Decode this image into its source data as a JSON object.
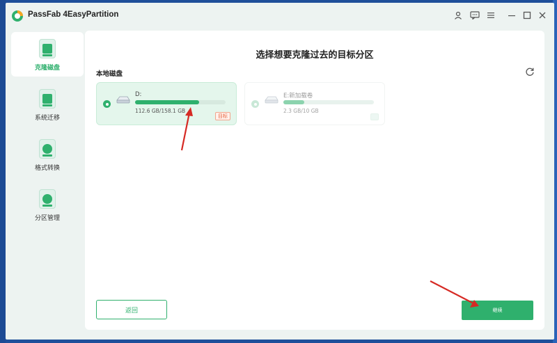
{
  "app": {
    "title": "PassFab 4EasyPartition"
  },
  "titlebar": {
    "icons": [
      "user-icon",
      "feedback-icon",
      "menu-icon",
      "minimize-icon",
      "maximize-icon",
      "close-icon"
    ]
  },
  "sidebar": {
    "items": [
      {
        "label": "克隆磁盘",
        "icon": "clone-disk-icon",
        "active": true
      },
      {
        "label": "系统迁移",
        "icon": "system-migrate-icon",
        "active": false
      },
      {
        "label": "格式转换",
        "icon": "format-convert-icon",
        "active": false
      },
      {
        "label": "分区管理",
        "icon": "partition-manage-icon",
        "active": false
      }
    ]
  },
  "main": {
    "title": "选择想要克隆过去的目标分区",
    "section_label": "本地磁盘",
    "partitions": [
      {
        "name": "D:",
        "size": "112.6 GB/158.1 GB",
        "used_fraction": 0.71,
        "badge": "目标",
        "selected": true
      },
      {
        "name": "E:新加载卷",
        "size": "2.3 GB/10 GB",
        "used_fraction": 0.23,
        "selected": false,
        "disabled": true
      }
    ],
    "back_label": "返回",
    "start_label": "继续"
  },
  "colors": {
    "accent": "#2fb06d",
    "arrow": "#d62a24",
    "badge": "#e8643e"
  }
}
